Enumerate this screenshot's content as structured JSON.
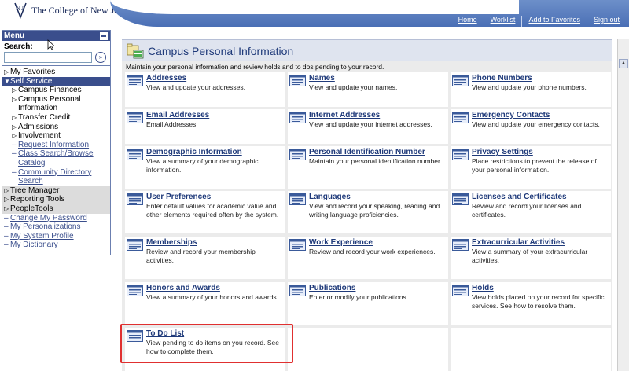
{
  "header": {
    "college_name": "The College of New Jersey",
    "nav": [
      "Home",
      "Worklist",
      "Add to Favorites",
      "Sign out"
    ]
  },
  "menu": {
    "title": "Menu",
    "search_label": "Search:",
    "search_value": "",
    "search_go": "»",
    "items": {
      "my_favorites": "My Favorites",
      "self_service": "Self Service",
      "campus_finances": "Campus Finances",
      "campus_personal_1": "Campus Personal",
      "campus_personal_2": "Information",
      "transfer_credit": "Transfer Credit",
      "admissions": "Admissions",
      "involvement": "Involvement",
      "request_information": "Request Information",
      "class_search_1": "Class Search/Browse",
      "class_search_2": "Catalog",
      "community_directory_1": "Community Directory",
      "community_directory_2": "Search",
      "tree_manager": "Tree Manager",
      "reporting_tools": "Reporting Tools",
      "peopletools": "PeopleTools",
      "change_password": "Change My Password",
      "my_personalizations": "My Personalizations",
      "my_system_profile": "My System Profile",
      "my_dictionary": "My Dictionary"
    }
  },
  "main": {
    "title": "Campus Personal Information",
    "description": "Maintain your personal information and review holds and to dos pending to your record.",
    "tiles": [
      {
        "title": "Addresses",
        "desc": "View and update your addresses."
      },
      {
        "title": "Names",
        "desc": "View and update your names."
      },
      {
        "title": "Phone Numbers",
        "desc": "View and update your phone numbers."
      },
      {
        "title": "Email Addresses",
        "desc": "Email Addresses."
      },
      {
        "title": "Internet Addresses",
        "desc": "View and update your internet addresses."
      },
      {
        "title": "Emergency Contacts",
        "desc": "View and update your emergency contacts."
      },
      {
        "title": "Demographic Information",
        "desc": "View a summary of your demographic information."
      },
      {
        "title": "Personal Identification Number",
        "desc": "Maintain your personal identification number."
      },
      {
        "title": "Privacy Settings",
        "desc": "Place restrictions to prevent the release of your personal information."
      },
      {
        "title": "User Preferences",
        "desc": "Enter default values for academic value and other elements required often by the system."
      },
      {
        "title": "Languages",
        "desc": "View and record your speaking, reading and writing language proficiencies."
      },
      {
        "title": "Licenses and Certificates",
        "desc": "Review and record your licenses and certificates."
      },
      {
        "title": "Memberships",
        "desc": "Review and record your membership activities."
      },
      {
        "title": "Work Experience",
        "desc": "Review and record your work experiences."
      },
      {
        "title": "Extracurricular Activities",
        "desc": "View a summary of your extracurricular activities."
      },
      {
        "title": "Honors and Awards",
        "desc": "View a summary of your honors and awards."
      },
      {
        "title": "Publications",
        "desc": "Enter or modify your publications."
      },
      {
        "title": "Holds",
        "desc": "View holds placed on your record for specific services. See how to resolve them."
      },
      {
        "title": "To Do List",
        "desc": "View pending to do items on you record. See how to complete them."
      }
    ]
  },
  "colors": {
    "header_blue": "#4a6fb5",
    "menu_dark": "#3a4e8c",
    "link_blue": "#1f3a7a",
    "highlight_red": "#e03030"
  }
}
